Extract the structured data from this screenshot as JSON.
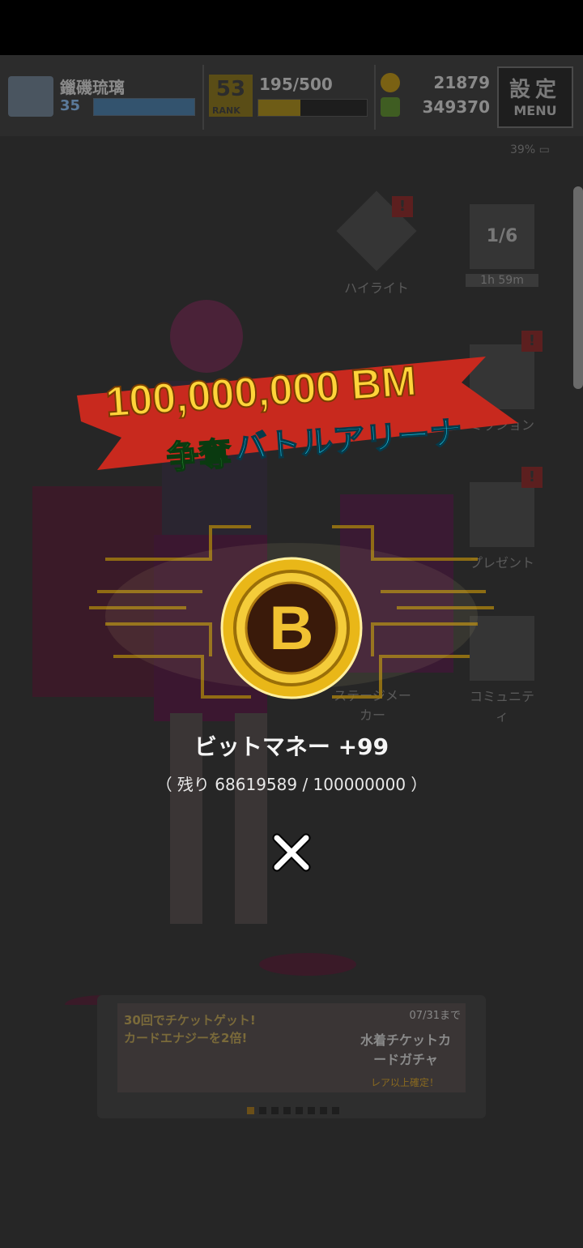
{
  "header": {
    "player_name": "鑞磯琉璃",
    "player_level": "35",
    "rank_number": "53",
    "rank_label": "RANK",
    "stamina": "195/500",
    "stamina_fraction": 0.39,
    "coins": "21879",
    "bit_money": "349370",
    "menu_kanji": "設定",
    "menu_label": "MENU"
  },
  "status": {
    "battery": "39%"
  },
  "menu_icons": {
    "highlight": "ハイライト",
    "timer_count": "1/6",
    "timer": "1h 59m",
    "mission": "ミッション",
    "present": "プレゼント",
    "stage_maker": "ステージメーカー",
    "community": "コミュニティ"
  },
  "event": {
    "title_amount": "100,000,000 BM",
    "title_sub_a": "争奪",
    "title_sub_b": "バトルアリーナ",
    "coin_letter": "B",
    "reward": "ビットマネー +99",
    "remaining": "（ 残り 68619589 / 100000000 ）",
    "colors": {
      "title_red": "#c8291e",
      "gold": "#e9b718",
      "green": "#39d24a",
      "cyan": "#18c3e6"
    }
  },
  "banner": {
    "left_text": "30回でチケットゲット! カードエナジーを2倍!",
    "date": "07/31まで",
    "right_text": "水着チケットカードガチャ",
    "right_sub": "レア以上確定！",
    "page_count": 8,
    "current_page": 1
  }
}
